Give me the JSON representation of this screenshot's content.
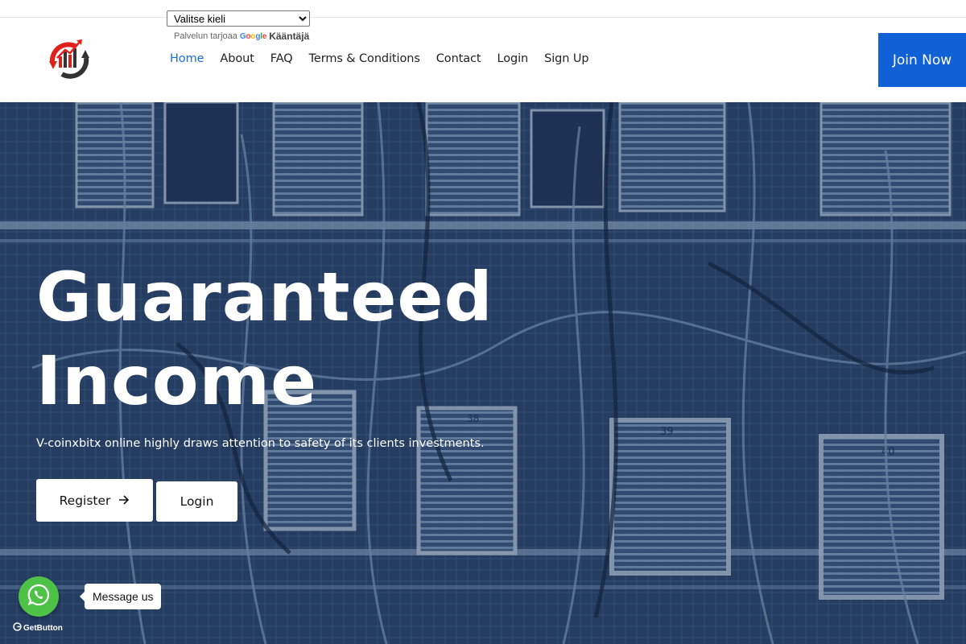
{
  "translate": {
    "select_value": "Valitse kieli",
    "powered_by": "Palvelun tarjoaa",
    "google_letters": [
      "G",
      "o",
      "o",
      "g",
      "l",
      "e"
    ],
    "translate_label": "Kääntäjä"
  },
  "header": {
    "logo_icon": "chart-arrows-logo",
    "nav": [
      {
        "label": "Home",
        "active": true
      },
      {
        "label": "About",
        "active": false
      },
      {
        "label": "FAQ",
        "active": false
      },
      {
        "label": "Terms & Conditions",
        "active": false
      },
      {
        "label": "Contact",
        "active": false
      },
      {
        "label": "Login",
        "active": false
      },
      {
        "label": "Sign Up",
        "active": false
      }
    ],
    "join_label": "Join Now"
  },
  "hero": {
    "title_line1": "Guaranteed",
    "title_line2": "Income",
    "subtitle": "V-coinxbitx online highly draws attention to safety of its clients investments.",
    "register_label": "Register",
    "register_icon": "arrow-right-icon",
    "login_label": "Login",
    "shelf_labels": [
      "38",
      "39",
      "40"
    ]
  },
  "widget": {
    "message_label": "Message us",
    "getbutton_label": "GetButton",
    "icon": "whatsapp-icon"
  },
  "colors": {
    "accent": "#1061d6",
    "active_nav": "#1a6fd6",
    "hero_tint": "#243a5c",
    "whatsapp": "#4dc247",
    "logo_red": "#e0201b",
    "logo_dark": "#333333"
  }
}
